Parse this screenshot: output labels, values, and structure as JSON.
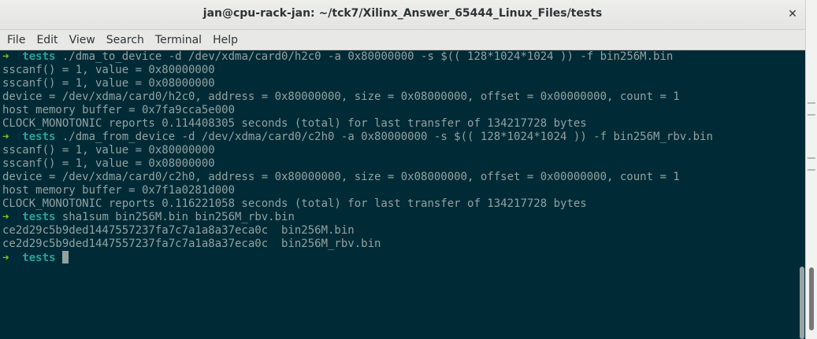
{
  "window": {
    "title": "jan@cpu-rack-jan: ~/tck7/Xilinx_Answer_65444_Linux_Files/tests",
    "close_glyph": "✕"
  },
  "menu": [
    "File",
    "Edit",
    "View",
    "Search",
    "Terminal",
    "Help"
  ],
  "terminal": {
    "prompt_arrow": "➜",
    "prompt_dir": "tests",
    "lines": [
      {
        "type": "prompt",
        "cmd": "./dma_to_device -d /dev/xdma/card0/h2c0 -a 0x80000000 -s $(( 128*1024*1024 )) -f bin256M.bin"
      },
      {
        "type": "out",
        "text": "sscanf() = 1, value = 0x80000000"
      },
      {
        "type": "out",
        "text": "sscanf() = 1, value = 0x08000000"
      },
      {
        "type": "out",
        "text": "device = /dev/xdma/card0/h2c0, address = 0x80000000, size = 0x08000000, offset = 0x00000000, count = 1"
      },
      {
        "type": "out",
        "text": "host memory buffer = 0x7fa9cca5e000"
      },
      {
        "type": "out",
        "text": "CLOCK_MONOTONIC reports 0.114408305 seconds (total) for last transfer of 134217728 bytes"
      },
      {
        "type": "prompt",
        "cmd": "./dma_from_device -d /dev/xdma/card0/c2h0 -a 0x80000000 -s $(( 128*1024*1024 )) -f bin256M_rbv.bin"
      },
      {
        "type": "out",
        "text": "sscanf() = 1, value = 0x80000000"
      },
      {
        "type": "out",
        "text": "sscanf() = 1, value = 0x08000000"
      },
      {
        "type": "out",
        "text": "device = /dev/xdma/card0/c2h0, address = 0x80000000, size = 0x08000000, offset = 0x00000000, count = 1"
      },
      {
        "type": "out",
        "text": "host memory buffer = 0x7f1a0281d000"
      },
      {
        "type": "out",
        "text": "CLOCK_MONOTONIC reports 0.116221058 seconds (total) for last transfer of 134217728 bytes"
      },
      {
        "type": "prompt",
        "cmd": "sha1sum bin256M.bin bin256M_rbv.bin"
      },
      {
        "type": "out",
        "text": "ce2d29c5b9ded1447557237fa7c7a1a8a37eca0c  bin256M.bin"
      },
      {
        "type": "out",
        "text": "ce2d29c5b9ded1447557237fa7c7a1a8a37eca0c  bin256M_rbv.bin"
      },
      {
        "type": "prompt",
        "cmd": "",
        "cursor": true
      }
    ]
  },
  "colors": {
    "background": "#002b36",
    "foreground": "#93a1a1",
    "prompt_arrow": "#85c01f",
    "prompt_dir": "#2aa198"
  }
}
